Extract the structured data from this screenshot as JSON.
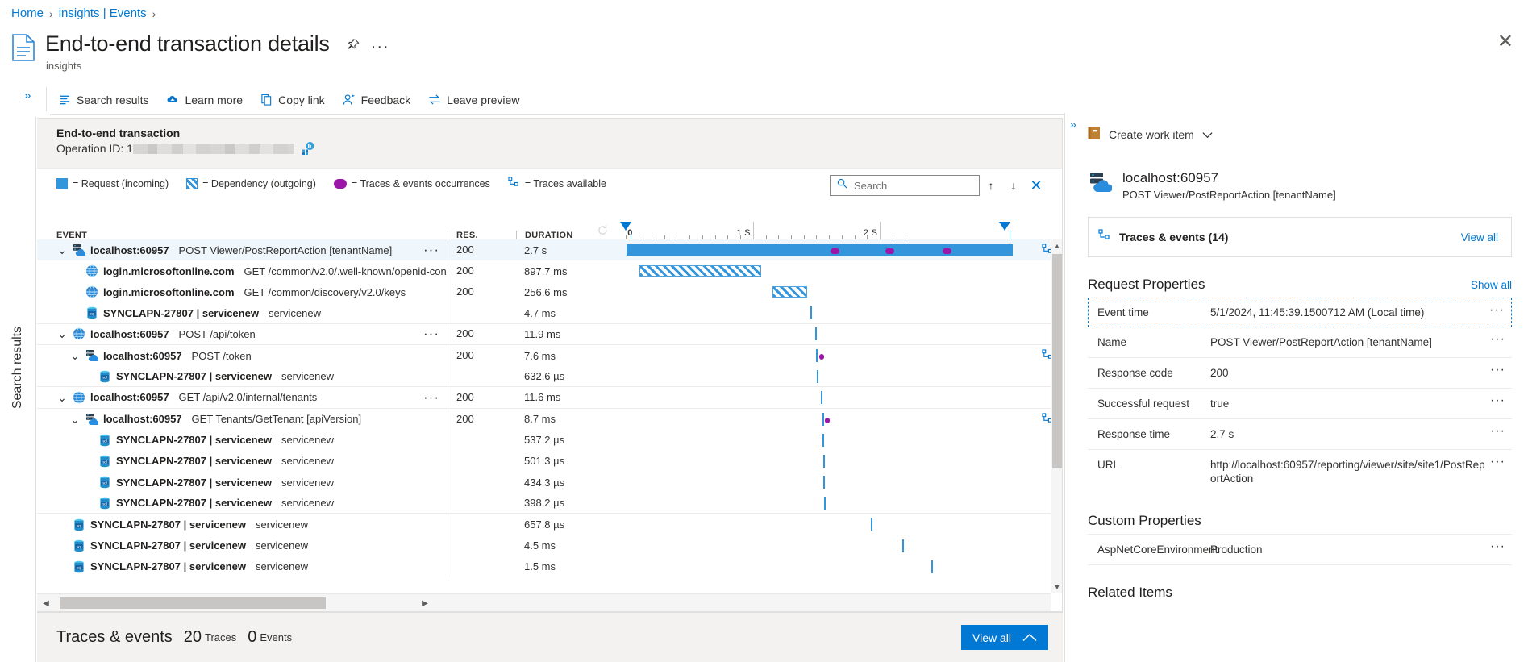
{
  "breadcrumb": {
    "items": [
      "Home",
      "insights | Events"
    ]
  },
  "header": {
    "title": "End-to-end transaction details",
    "subtitle": "insights",
    "pin_icon": "pin-icon",
    "more_icon": "ellipsis-icon",
    "close_icon": "close-icon"
  },
  "commandbar": {
    "expand_icon": "double-chevron-right-icon",
    "items": [
      {
        "label": "Search results",
        "icon": "list-icon"
      },
      {
        "label": "Learn more",
        "icon": "learn-cloud-icon"
      },
      {
        "label": "Copy link",
        "icon": "copy-icon"
      },
      {
        "label": "Feedback",
        "icon": "person-feedback-icon"
      },
      {
        "label": "Leave preview",
        "icon": "swap-arrows-icon"
      }
    ]
  },
  "rail": {
    "label": "Search results"
  },
  "transaction": {
    "title": "End-to-end transaction",
    "operation_id_label": "Operation ID:",
    "operation_id_value": "1",
    "operation_id_redacted": true,
    "chart_icon": "metrics-chart-icon"
  },
  "legend": [
    {
      "label": "= Request (incoming)",
      "swatch": "request"
    },
    {
      "label": "= Dependency (outgoing)",
      "swatch": "dependency"
    },
    {
      "label": "= Traces & events occurrences",
      "swatch": "trace"
    },
    {
      "label": "= Traces available",
      "swatch": "traces-available"
    }
  ],
  "search": {
    "placeholder": "Search",
    "value": "",
    "search_icon": "search-icon",
    "prev_icon": "arrow-up-icon",
    "next_icon": "arrow-down-icon",
    "close_icon": "close-icon"
  },
  "table": {
    "columns": {
      "event": "EVENT",
      "res": "RES.",
      "duration": "DURATION"
    },
    "ruler": {
      "ticks": [
        "0",
        "1 S",
        "2 S"
      ],
      "tick_positions_pct": [
        3.0,
        32.0,
        61.0
      ],
      "markers_pct": [
        3.0,
        89.5
      ],
      "refresh_icon": "refresh-icon"
    },
    "rows": [
      {
        "indent": 0,
        "caret": "expanded",
        "icon": "request-server-icon",
        "host": "localhost:60957",
        "name": "POST Viewer/PostReportAction [tenantName]",
        "res": "200",
        "duration": "2.7 s",
        "selected": true,
        "more": true,
        "bar": {
          "type": "solid",
          "left_pct": 3.0,
          "width_pct": 86.0
        },
        "dots_pct": [
          48.5,
          60.7,
          73.5
        ],
        "traces_icon": true
      },
      {
        "indent": 1,
        "caret": "none",
        "icon": "dependency-globe-icon",
        "host": "login.microsoftonline.com",
        "name": "GET /common/v2.0/.well-known/openid-con",
        "res": "200",
        "duration": "897.7 ms",
        "selected": false,
        "more": false,
        "bar": {
          "type": "hatch",
          "left_pct": 6.0,
          "width_pct": 27.0
        },
        "dots_pct": []
      },
      {
        "indent": 1,
        "caret": "none",
        "icon": "dependency-globe-icon",
        "host": "login.microsoftonline.com",
        "name": "GET /common/discovery/v2.0/keys",
        "res": "200",
        "duration": "256.6 ms",
        "selected": false,
        "more": false,
        "bar": {
          "type": "hatch",
          "left_pct": 35.5,
          "width_pct": 7.8
        },
        "dots_pct": []
      },
      {
        "indent": 1,
        "caret": "none",
        "icon": "sql-icon",
        "host": "SYNCLAPN-27807 | servicenew",
        "name": "servicenew",
        "res": "",
        "duration": "4.7 ms",
        "selected": false,
        "more": false,
        "rule": true,
        "bar": {
          "type": "thin",
          "left_pct": 44.0
        },
        "dots_pct": []
      },
      {
        "indent": 0,
        "caret": "expanded",
        "icon": "dependency-globe-icon",
        "host": "localhost:60957",
        "name": "POST /api/token",
        "res": "200",
        "duration": "11.9 ms",
        "selected": false,
        "more": true,
        "rule": true,
        "bar": {
          "type": "thin",
          "left_pct": 45.0
        },
        "dots_pct": []
      },
      {
        "indent": 1,
        "caret": "expanded",
        "icon": "request-server-icon",
        "host": "localhost:60957",
        "name": "POST /token",
        "res": "200",
        "duration": "7.6 ms",
        "selected": false,
        "more": false,
        "bar": {
          "type": "thin",
          "left_pct": 45.3
        },
        "dots_pct": [
          46.0
        ],
        "traces_icon": true
      },
      {
        "indent": 2,
        "caret": "none",
        "icon": "sql-icon",
        "host": "SYNCLAPN-27807 | servicenew",
        "name": "servicenew",
        "res": "",
        "duration": "632.6 µs",
        "selected": false,
        "more": false,
        "rule": true,
        "bar": {
          "type": "thin",
          "left_pct": 45.5
        },
        "dots_pct": []
      },
      {
        "indent": 0,
        "caret": "expanded",
        "icon": "dependency-globe-icon",
        "host": "localhost:60957",
        "name": "GET /api/v2.0/internal/tenants",
        "res": "200",
        "duration": "11.6 ms",
        "selected": false,
        "more": true,
        "rule": true,
        "bar": {
          "type": "thin",
          "left_pct": 46.3
        },
        "dots_pct": []
      },
      {
        "indent": 1,
        "caret": "expanded",
        "icon": "request-server-icon",
        "host": "localhost:60957",
        "name": "GET Tenants/GetTenant [apiVersion]",
        "res": "200",
        "duration": "8.7 ms",
        "selected": false,
        "more": false,
        "bar": {
          "type": "thin",
          "left_pct": 46.6
        },
        "dots_pct": [
          47.2
        ],
        "traces_icon": true
      },
      {
        "indent": 2,
        "caret": "none",
        "icon": "sql-icon",
        "host": "SYNCLAPN-27807 | servicenew",
        "name": "servicenew",
        "res": "",
        "duration": "537.2 µs",
        "selected": false,
        "more": false,
        "bar": {
          "type": "thin",
          "left_pct": 46.7
        },
        "dots_pct": []
      },
      {
        "indent": 2,
        "caret": "none",
        "icon": "sql-icon",
        "host": "SYNCLAPN-27807 | servicenew",
        "name": "servicenew",
        "res": "",
        "duration": "501.3 µs",
        "selected": false,
        "more": false,
        "bar": {
          "type": "thin",
          "left_pct": 46.8
        },
        "dots_pct": []
      },
      {
        "indent": 2,
        "caret": "none",
        "icon": "sql-icon",
        "host": "SYNCLAPN-27807 | servicenew",
        "name": "servicenew",
        "res": "",
        "duration": "434.3 µs",
        "selected": false,
        "more": false,
        "bar": {
          "type": "thin",
          "left_pct": 46.9
        },
        "dots_pct": []
      },
      {
        "indent": 2,
        "caret": "none",
        "icon": "sql-icon",
        "host": "SYNCLAPN-27807 | servicenew",
        "name": "servicenew",
        "res": "",
        "duration": "398.2 µs",
        "selected": false,
        "more": false,
        "rule": true,
        "bar": {
          "type": "thin",
          "left_pct": 47.0
        },
        "dots_pct": []
      },
      {
        "indent": 0,
        "caret": "none",
        "icon": "sql-icon",
        "host": "SYNCLAPN-27807 | servicenew",
        "name": "servicenew",
        "res": "",
        "duration": "657.8 µs",
        "selected": false,
        "more": false,
        "bar": {
          "type": "thin",
          "left_pct": 57.5
        },
        "dots_pct": []
      },
      {
        "indent": 0,
        "caret": "none",
        "icon": "sql-icon",
        "host": "SYNCLAPN-27807 | servicenew",
        "name": "servicenew",
        "res": "",
        "duration": "4.5 ms",
        "selected": false,
        "more": false,
        "bar": {
          "type": "thin",
          "left_pct": 64.5
        },
        "dots_pct": []
      },
      {
        "indent": 0,
        "caret": "none",
        "icon": "sql-icon",
        "host": "SYNCLAPN-27807 | servicenew",
        "name": "servicenew",
        "res": "",
        "duration": "1.5 ms",
        "selected": false,
        "more": false,
        "bar": {
          "type": "thin",
          "left_pct": 71.0
        },
        "dots_pct": []
      }
    ]
  },
  "bottom": {
    "title": "Traces & events",
    "traces_count": "20",
    "traces_unit": "Traces",
    "events_count": "0",
    "events_unit": "Events",
    "view_all": "View all",
    "chevron_icon": "chevron-up-icon"
  },
  "details": {
    "collapse_icon": "double-chevron-right-icon",
    "create_work_item": {
      "label": "Create work item",
      "icon": "work-item-icon",
      "chevron": "chevron-down-icon"
    },
    "identity": {
      "title": "localhost:60957",
      "subtitle": "POST Viewer/PostReportAction [tenantName]",
      "icon": "request-server-icon"
    },
    "traces_card": {
      "label": "Traces & events (14)",
      "link": "View all",
      "icon": "traces-icon"
    },
    "request_properties": {
      "title": "Request Properties",
      "link": "Show all",
      "rows": [
        {
          "key": "Event time",
          "value": "5/1/2024, 11:45:39.1500712 AM (Local time)",
          "focused": true
        },
        {
          "key": "Name",
          "value": "POST Viewer/PostReportAction [tenantName]",
          "focused": false
        },
        {
          "key": "Response code",
          "value": "200",
          "focused": false
        },
        {
          "key": "Successful request",
          "value": "true",
          "focused": false
        },
        {
          "key": "Response time",
          "value": "2.7 s",
          "focused": false
        },
        {
          "key": "URL",
          "value": "http://localhost:60957/reporting/viewer/site/site1/PostReportAction",
          "focused": false
        }
      ]
    },
    "custom_properties": {
      "title": "Custom Properties",
      "rows": [
        {
          "key": "AspNetCoreEnvironment",
          "value": "Production"
        }
      ]
    },
    "related_items": {
      "title": "Related Items"
    }
  },
  "colors": {
    "accent": "#0078d4",
    "request": "#3396dd",
    "trace": "#9b17a8",
    "border": "#e1dfdd"
  }
}
